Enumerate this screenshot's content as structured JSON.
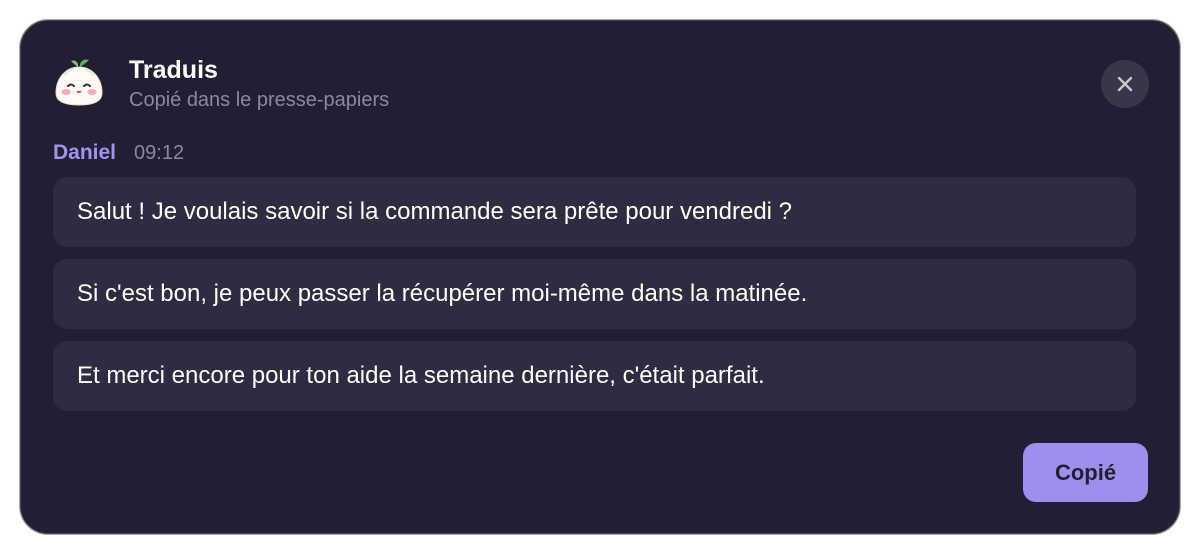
{
  "header": {
    "title": "Traduis",
    "subtitle": "Copié dans le presse-papiers",
    "app_icon": "dumpling-mascot-icon",
    "close_icon": "close-icon"
  },
  "conversation": {
    "sender": "Daniel",
    "time": "09:12",
    "messages": [
      "Salut ! Je voulais savoir si la commande sera prête pour vendredi ?",
      "Si c'est bon, je peux passer la récupérer moi-même dans la matinée.",
      "Et merci encore pour ton aide la semaine dernière, c'était parfait."
    ]
  },
  "actions": {
    "copy_label": "Copié"
  },
  "colors": {
    "background": "#231e33",
    "bubble": "#302b40",
    "accent": "#9f8fec",
    "sender_name": "#a393ec",
    "muted_text": "#8d889c"
  }
}
